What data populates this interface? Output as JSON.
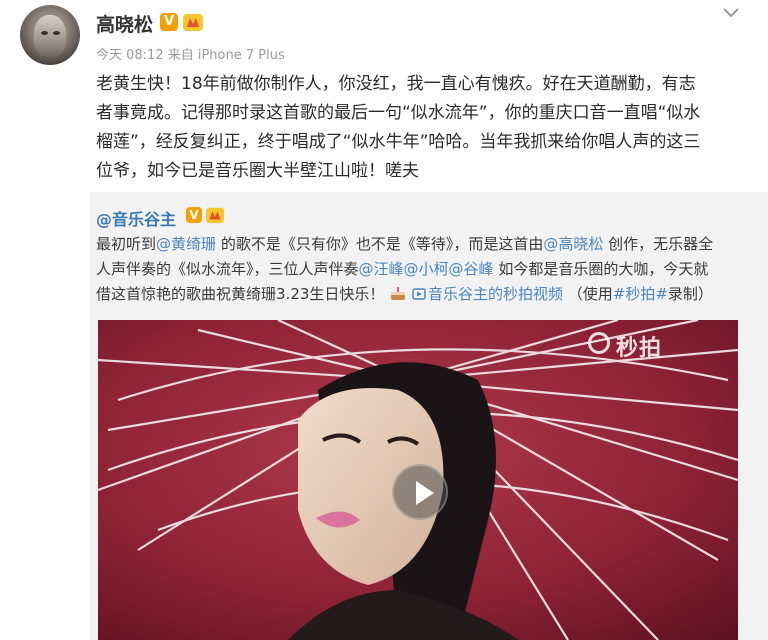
{
  "post": {
    "author": "高晓松",
    "badge_v": "V",
    "meta": "今天 08:12 来自 iPhone 7 Plus",
    "text_lines": [
      "老黄生快！18年前做你制作人，你没红，我一直心有愧疚。好在天道酬勤，有志",
      "者事竟成。记得那时录这首歌的最后一句“似水流年”，你的重庆口音一直唱“似水",
      "榴莲”，经反复纠正，终于唱成了“似水牛年”哈哈。当年我抓来给你唱人声的这三",
      "位爷，如今已是音乐圈大半壁江山啦！嗟夫"
    ]
  },
  "repost": {
    "author": "@音乐谷主",
    "badge_v": "V",
    "line1_a": "最初听到",
    "mention1": "@黄绮珊",
    "line1_b": "的歌不是《只有你》也不是《等待》，而是这首由",
    "mention2": "@高晓松",
    "line1_c": "创作，无乐器全",
    "line2_a": "人声伴奏的《似水流年》，三位人声伴奏",
    "mention3": "@汪峰",
    "mention4": "@小柯",
    "mention5": "@谷峰",
    "line2_b": "如今都是音乐圈的大咖，今天就",
    "line3_a": "借这首惊艳的歌曲祝黄绮珊3.23生日快乐！",
    "video_link": "音乐谷主的秒拍视频",
    "line3_b": "（使用",
    "hashtag": "#秒拍#",
    "line3_c": "录制）"
  },
  "video": {
    "watermark": "秒拍"
  },
  "colors": {
    "link": "#4a86c0",
    "badge": "#f2a007",
    "video_bg": "#8a1e2e"
  },
  "icons": [
    "more-icon",
    "v-badge-icon",
    "level-badge-icon",
    "cake-icon",
    "video-link-icon",
    "play-icon"
  ]
}
